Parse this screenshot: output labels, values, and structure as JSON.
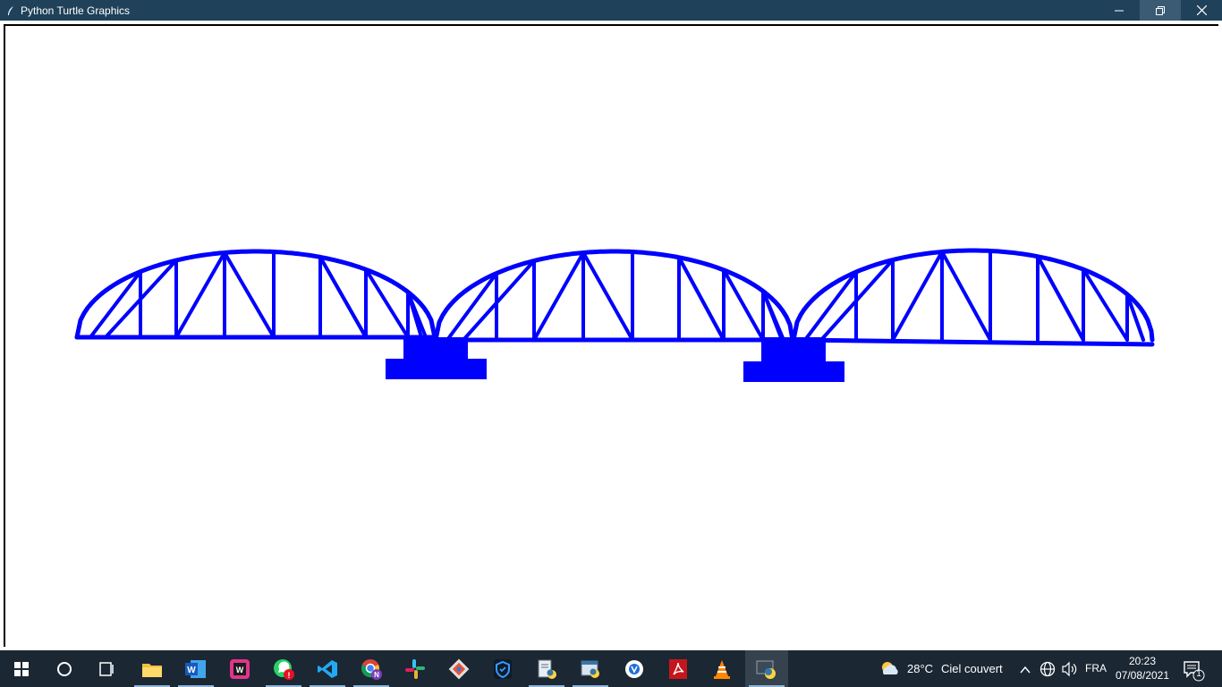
{
  "window": {
    "title": "Python Turtle Graphics",
    "controls": [
      "minimize",
      "restore",
      "close"
    ]
  },
  "canvas": {
    "drawing": "bridge",
    "stroke_color": "#0000ff",
    "fill_color": "#0000ff",
    "background": "#ffffff"
  },
  "taskbar": {
    "apps": [
      {
        "name": "start-menu",
        "icon": "windows-logo-icon"
      },
      {
        "name": "search",
        "icon": "search-circle-icon"
      },
      {
        "name": "task-view",
        "icon": "task-view-icon"
      },
      {
        "name": "file-explorer",
        "icon": "folder-icon"
      },
      {
        "name": "word",
        "icon": "word-icon"
      },
      {
        "name": "webstorm",
        "icon": "webstorm-icon"
      },
      {
        "name": "whatsapp",
        "icon": "whatsapp-icon"
      },
      {
        "name": "vscode",
        "icon": "vscode-icon"
      },
      {
        "name": "chrome",
        "icon": "chrome-icon"
      },
      {
        "name": "slack",
        "icon": "slack-icon"
      },
      {
        "name": "git",
        "icon": "git-icon"
      },
      {
        "name": "security",
        "icon": "shield-icon"
      },
      {
        "name": "notepad",
        "icon": "notepad-icon"
      },
      {
        "name": "python-idle",
        "icon": "python-file-icon"
      },
      {
        "name": "signal",
        "icon": "app-circle-icon"
      },
      {
        "name": "acrobat",
        "icon": "pdf-icon"
      },
      {
        "name": "vlc",
        "icon": "vlc-cone-icon"
      },
      {
        "name": "python-turtle",
        "icon": "python-icon"
      }
    ],
    "tray": {
      "weather_temp": "28°C",
      "weather_desc": "Ciel couvert",
      "language": "FRA",
      "time": "20:23",
      "date": "07/08/2021",
      "notification_count": "1"
    }
  }
}
